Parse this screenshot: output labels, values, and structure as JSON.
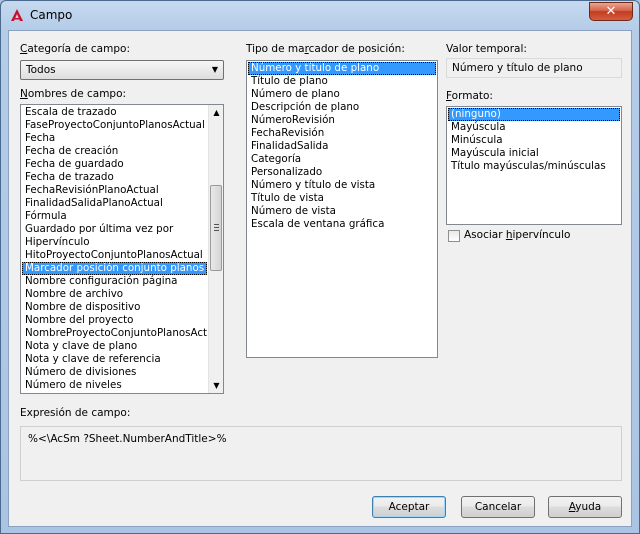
{
  "window": {
    "title": "Campo",
    "close_glyph": "✕"
  },
  "category": {
    "label_u": "C",
    "label_rest": "ategoría de campo:",
    "selected": "Todos"
  },
  "field_names": {
    "label_u": "N",
    "label_rest": "ombres de campo:",
    "items": [
      "Escala de trazado",
      "FaseProyectoConjuntoPlanosActual",
      "Fecha",
      "Fecha de creación",
      "Fecha de guardado",
      "Fecha de trazado",
      "FechaRevisiónPlanoActual",
      "FinalidadSalidaPlanoActual",
      "Fórmula",
      "Guardado por última vez por",
      "Hipervínculo",
      "HitoProyectoConjuntoPlanosActual",
      "Marcador posición conjunto planos",
      "Nombre configuración página",
      "Nombre de archivo",
      "Nombre de dispositivo",
      "Nombre del proyecto",
      "NombreProyectoConjuntoPlanosActual",
      "Nota y clave de plano",
      "Nota y clave de referencia",
      "Número de divisiones",
      "Número de niveles"
    ],
    "selected_index": 12
  },
  "placeholder_type": {
    "label_pre": "Tipo de ma",
    "label_u": "r",
    "label_post": "cador de posición:",
    "items": [
      "Número y título de plano",
      "Título de plano",
      "Número de plano",
      "Descripción de plano",
      "NúmeroRevisión",
      "FechaRevisión",
      "FinalidadSalida",
      "Categoría",
      "Personalizado",
      "Número y título de vista",
      "Título de vista",
      "Número de vista",
      "Escala de ventana gráfica"
    ],
    "selected_index": 0
  },
  "temp_value": {
    "label": "Valor temporal:",
    "value": "Número y título de plano"
  },
  "format": {
    "label_u": "F",
    "label_rest": "ormato:",
    "items": [
      "(ninguno)",
      "Mayúscula",
      "Minúscula",
      "Mayúscula inicial",
      "Título mayúsculas/minúsculas"
    ],
    "selected_index": 0
  },
  "hyperlink": {
    "label_pre": "Asociar ",
    "label_u": "h",
    "label_post": "ipervínculo",
    "checked": false
  },
  "expression": {
    "label": "Expresión de campo:",
    "value": "%<\\AcSm ?Sheet.NumberAndTitle>%"
  },
  "buttons": {
    "ok": "Aceptar",
    "cancel": "Cancelar",
    "help_u": "A",
    "help_rest": "yuda"
  },
  "colors": {
    "selection": "#3399ff",
    "autocad_red": "#c8102e"
  }
}
